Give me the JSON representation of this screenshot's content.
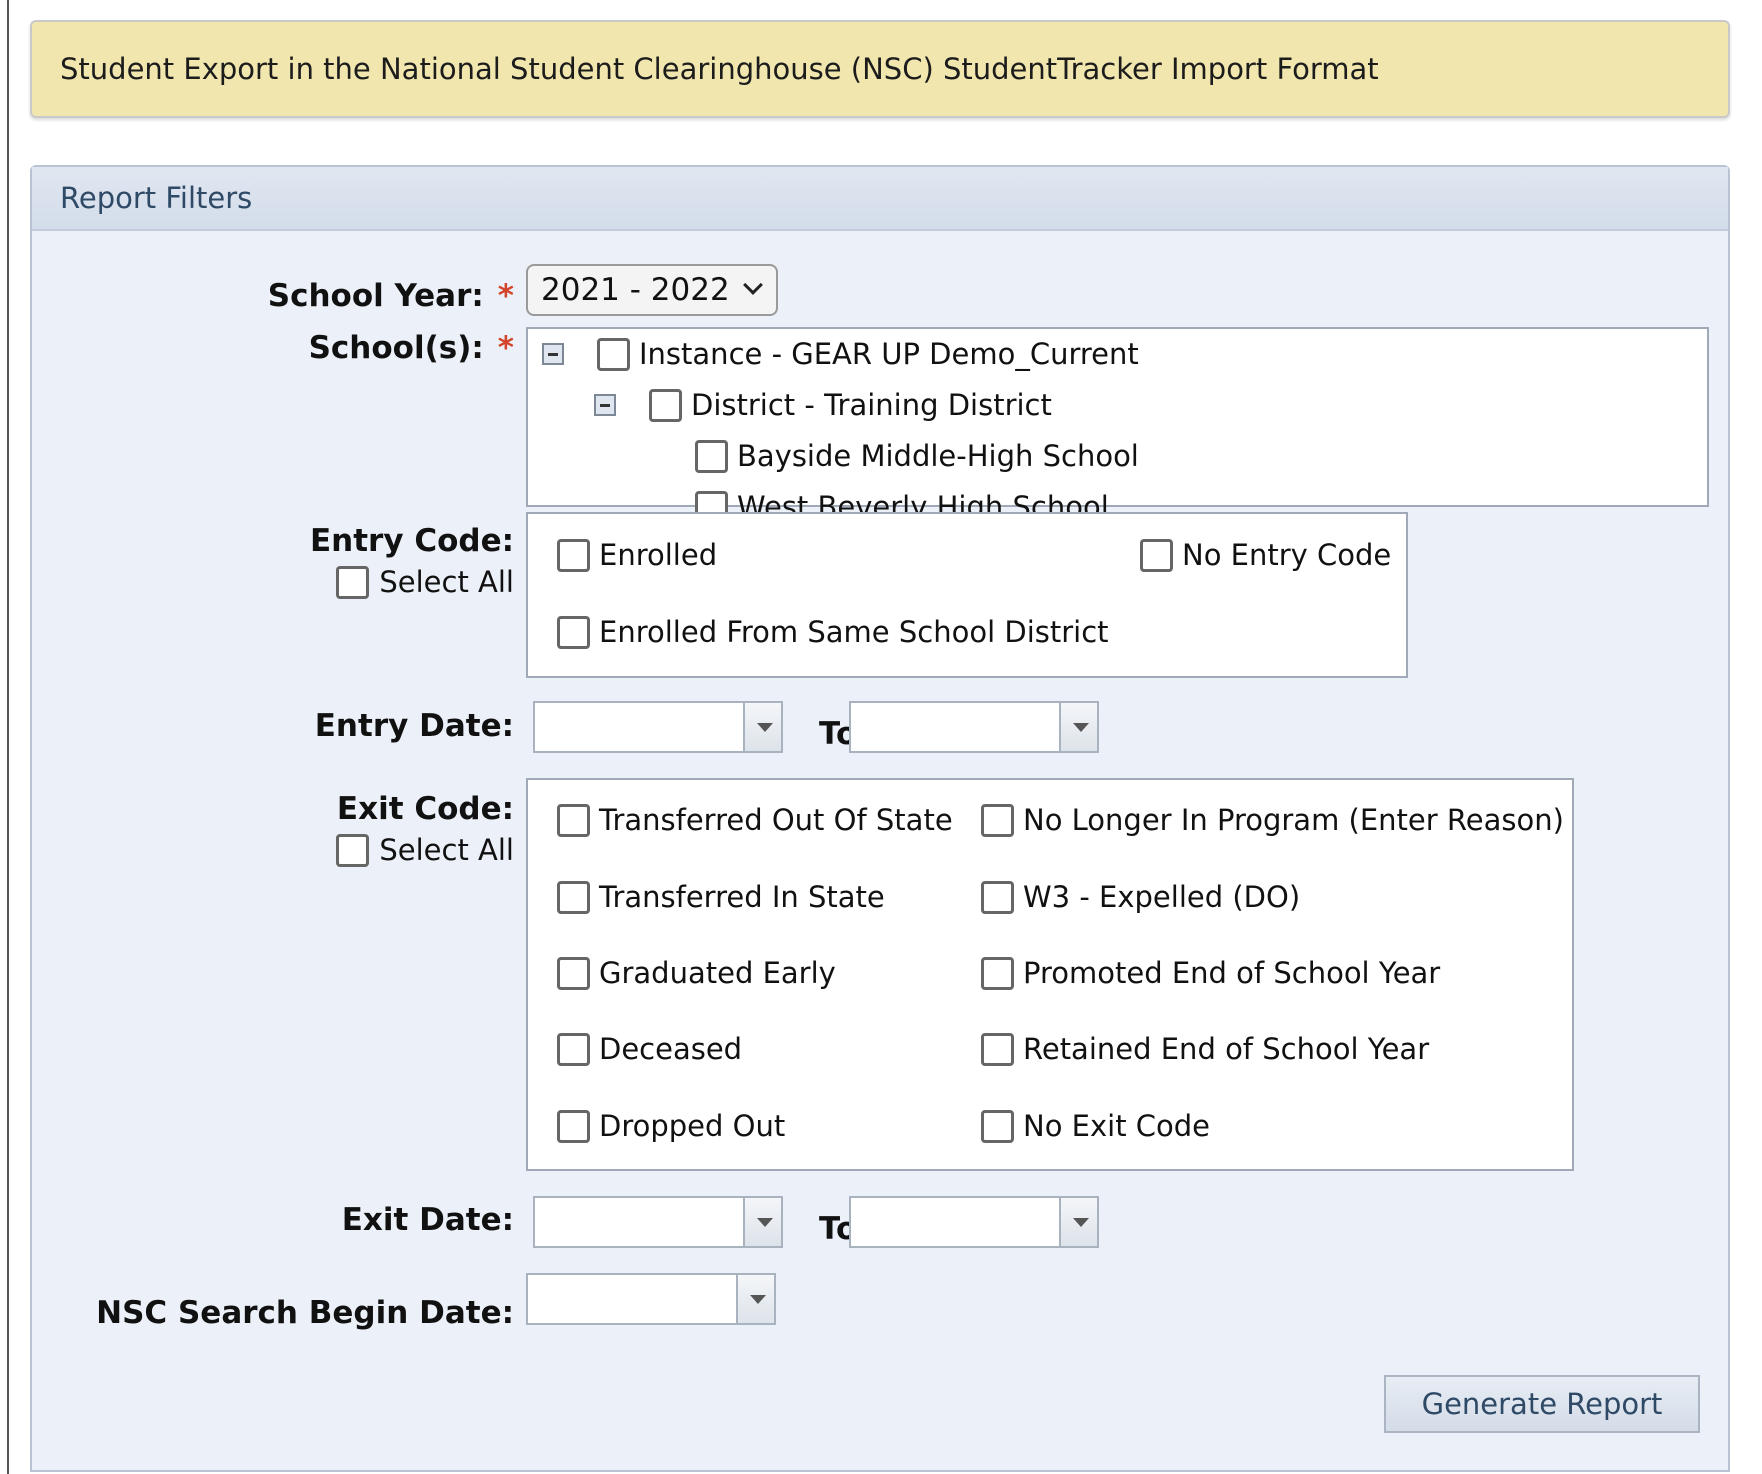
{
  "title": "Student Export in the National Student Clearinghouse (NSC) StudentTracker Import Format",
  "panel_title": "Report Filters",
  "required_marker": "*",
  "school_year": {
    "label": "School Year:",
    "value": "2021 - 2022"
  },
  "schools": {
    "label": "School(s):",
    "instance": "Instance - GEAR UP Demo_Current",
    "district": "District - Training District",
    "items": [
      "Bayside Middle-High School",
      "West Beverly High School"
    ]
  },
  "entry_code": {
    "label": "Entry Code:",
    "select_all": "Select All",
    "options": [
      "Enrolled",
      "No Entry Code",
      "Enrolled From Same School District"
    ]
  },
  "entry_date": {
    "label": "Entry Date:",
    "to_label": "To"
  },
  "exit_code": {
    "label": "Exit Code:",
    "select_all": "Select All",
    "options": [
      "Transferred Out Of State",
      "No Longer In Program (Enter Reason)",
      "Transferred In State",
      "W3 - Expelled (DO)",
      "Graduated Early",
      "Promoted End of School Year",
      "Deceased",
      "Retained End of School Year",
      "Dropped Out",
      "No Exit Code"
    ]
  },
  "exit_date": {
    "label": "Exit Date:",
    "to_label": "To"
  },
  "nsc_search": {
    "label": "NSC Search Begin Date:"
  },
  "generate_button": "Generate Report",
  "colors": {
    "title_bg": "#f1e6ae",
    "panel_bg": "#ecf1f9",
    "required": "#d2452b",
    "header_text": "#2f4a66"
  }
}
